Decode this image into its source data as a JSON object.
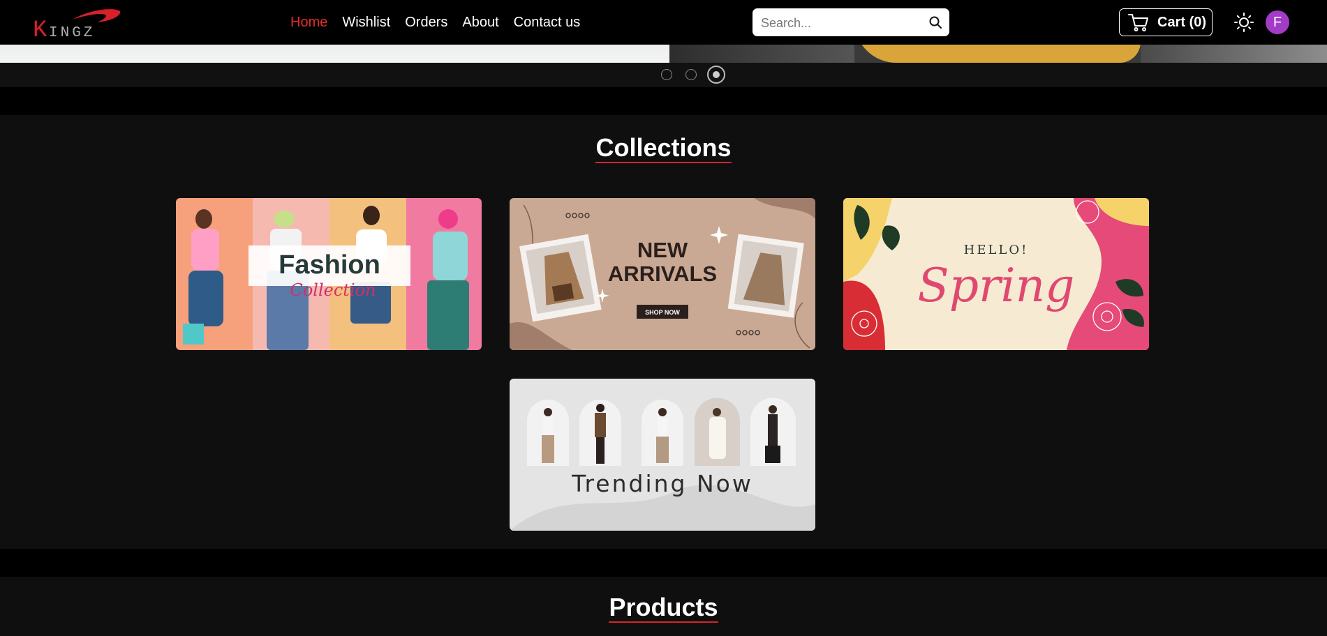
{
  "brand": {
    "logo_text": "KINGZ",
    "accent": "#e52d2d"
  },
  "nav": {
    "links": [
      {
        "label": "Home",
        "active": true
      },
      {
        "label": "Wishlist",
        "active": false
      },
      {
        "label": "Orders",
        "active": false
      },
      {
        "label": "About",
        "active": false
      },
      {
        "label": "Contact us",
        "active": false
      }
    ]
  },
  "search": {
    "placeholder": "Search..."
  },
  "cart": {
    "label": "Cart (0)"
  },
  "user": {
    "avatar_initial": "F",
    "avatar_color": "#a23bc6"
  },
  "carousel": {
    "slide_count": 3,
    "active_index": 2
  },
  "collections": {
    "title": "Collections",
    "cards": [
      {
        "id": "fashion",
        "heading": "Fashion",
        "subheading": "Collection"
      },
      {
        "id": "new-arrivals",
        "heading_line1": "NEW",
        "heading_line2": "ARRIVALS",
        "button": "SHOP NOW"
      },
      {
        "id": "spring",
        "heading_small": "HELLO!",
        "heading": "Spring"
      },
      {
        "id": "trending",
        "heading": "Trending Now"
      }
    ]
  },
  "products": {
    "title": "Products"
  }
}
